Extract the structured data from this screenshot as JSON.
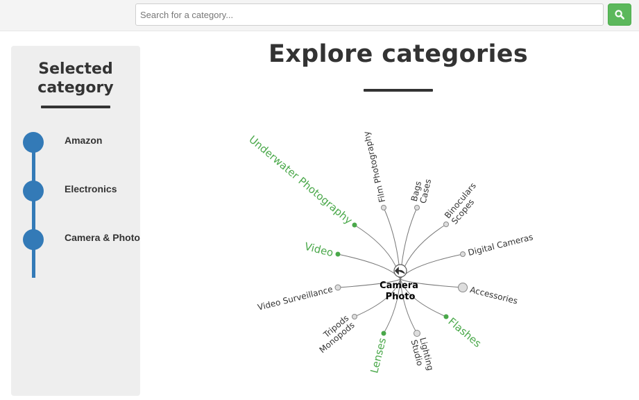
{
  "search": {
    "placeholder": "Search for a category...",
    "button_icon": "search-icon"
  },
  "sidebar": {
    "title_line1": "Selected",
    "title_line2": "category",
    "items": [
      {
        "label": "Amazon"
      },
      {
        "label": "Electronics"
      },
      {
        "label": "Camera & Photo"
      }
    ]
  },
  "main": {
    "title": "Explore categories",
    "tree": {
      "center_line1": "Camera",
      "center_line2": "Photo",
      "back_icon": "back-arrow-icon",
      "colors": {
        "expandable": "#4aa84a",
        "leaf": "#333333",
        "accent": "#337ab7",
        "button": "#5cb85c"
      },
      "children": [
        {
          "name": "film-photography",
          "lines": [
            "Film Photography"
          ],
          "expandable": false
        },
        {
          "name": "bags-cases",
          "lines": [
            "Bags",
            "Cases"
          ],
          "expandable": false
        },
        {
          "name": "binoculars-scopes",
          "lines": [
            "Binoculars",
            "Scopes"
          ],
          "expandable": false
        },
        {
          "name": "digital-cameras",
          "lines": [
            "Digital Cameras"
          ],
          "expandable": false
        },
        {
          "name": "accessories",
          "lines": [
            "Accessories"
          ],
          "expandable": false
        },
        {
          "name": "flashes",
          "lines": [
            "Flashes"
          ],
          "expandable": true
        },
        {
          "name": "lighting-studio",
          "lines": [
            "Lighting",
            "Studio"
          ],
          "expandable": false
        },
        {
          "name": "lenses",
          "lines": [
            "Lenses"
          ],
          "expandable": true
        },
        {
          "name": "tripods-monopods",
          "lines": [
            "Tripods",
            "Monopods"
          ],
          "expandable": false
        },
        {
          "name": "video-surveillance",
          "lines": [
            "Video Surveillance"
          ],
          "expandable": false
        },
        {
          "name": "video",
          "lines": [
            "Video"
          ],
          "expandable": true
        },
        {
          "name": "underwater-photography",
          "lines": [
            "Underwater Photography"
          ],
          "expandable": true
        }
      ]
    }
  }
}
